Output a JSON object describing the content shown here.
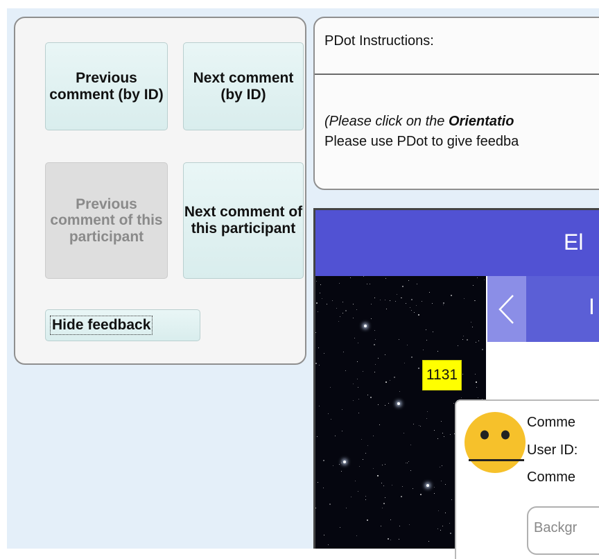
{
  "nav": {
    "prev_by_id": "Previous comment (by ID)",
    "next_by_id": "Next comment (by ID)",
    "prev_participant": "Previous comment of this participant",
    "next_participant": "Next comment of this participant",
    "hide_feedback": "Hide feedback"
  },
  "instructions": {
    "title": "PDot Instructions:",
    "line1_prefix": "(Please click on the ",
    "line1_bold": "Orientatio",
    "line2": "Please use PDot to give feedba"
  },
  "app": {
    "header_title": "El",
    "subbar_letter": "I",
    "prev_icon": "chevron-left-icon"
  },
  "comment": {
    "id_label": "1131",
    "line1": "Comme",
    "line2": "User ID:",
    "line3": "Comme",
    "background_placeholder": "Backgr",
    "face_icon": "neutral-face-icon"
  },
  "colors": {
    "page_bg": "#e4eff9",
    "header_blue": "#5152d3",
    "id_tag": "#ffff00",
    "emoji_yellow": "#f6c12b"
  }
}
